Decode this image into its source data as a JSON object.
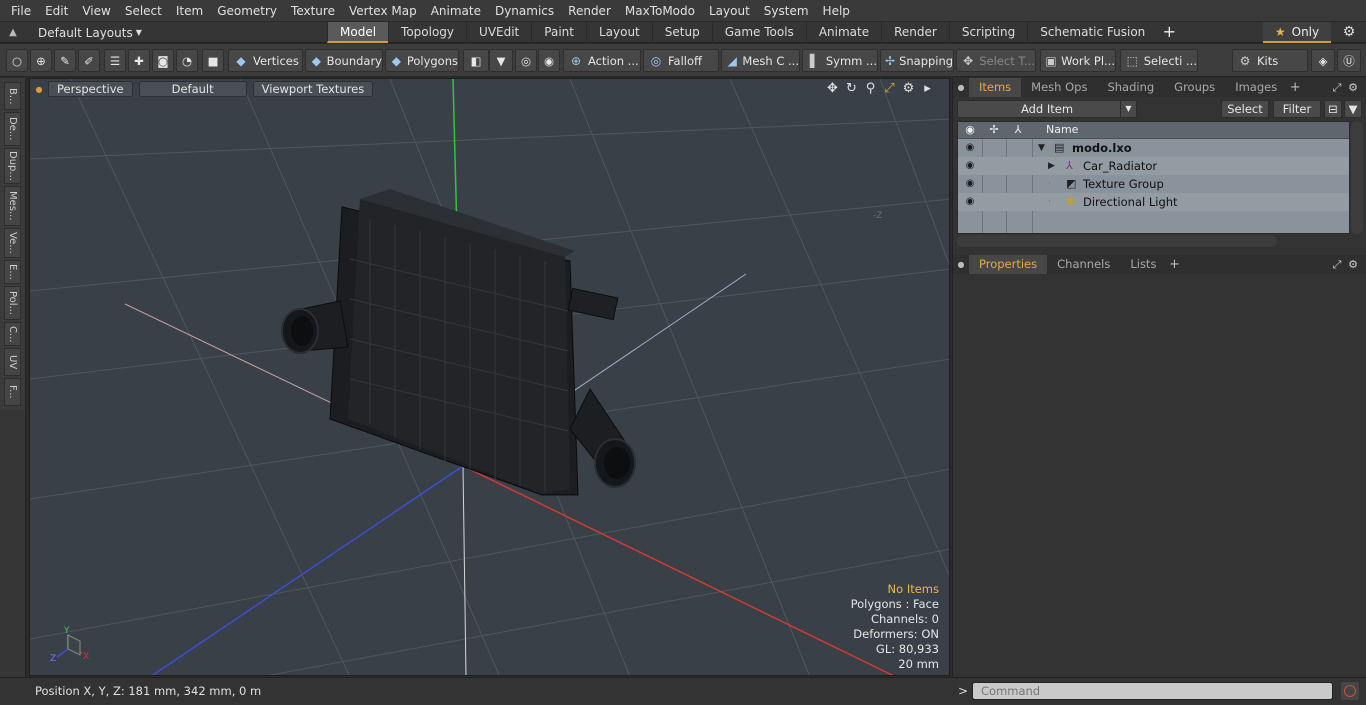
{
  "menu": [
    "File",
    "Edit",
    "View",
    "Select",
    "Item",
    "Geometry",
    "Texture",
    "Vertex Map",
    "Animate",
    "Dynamics",
    "Render",
    "MaxToModo",
    "Layout",
    "System",
    "Help"
  ],
  "layouts": {
    "label": "Default Layouts"
  },
  "tabs": [
    "Model",
    "Topology",
    "UVEdit",
    "Paint",
    "Layout",
    "Setup",
    "Game Tools",
    "Animate",
    "Render",
    "Scripting",
    "Schematic Fusion"
  ],
  "only_label": "Only",
  "toolbar": {
    "vertices": "Vertices",
    "boundary": "Boundary",
    "polygons": "Polygons",
    "action": "Action ...",
    "falloff": "Falloff",
    "mesh": "Mesh C ...",
    "symm": "Symm ...",
    "snapping": "Snapping",
    "select_t": "Select T...",
    "work_pl": "Work Pl...",
    "selecti": "Selecti ...",
    "kits": "Kits"
  },
  "left_tabs": [
    "B...",
    "De...",
    "Dup...",
    "Mes...",
    "Ve...",
    "E...",
    "Pol...",
    "C...",
    "UV",
    "F..."
  ],
  "viewport": {
    "perspective": "Perspective",
    "default": "Default",
    "textures": "Viewport Textures",
    "neg_z": "-Z",
    "axis_x": "X",
    "axis_y": "Y",
    "axis_z": "Z"
  },
  "stats": {
    "no_items": "No Items",
    "polygons": "Polygons : Face",
    "channels": "Channels: 0",
    "deformers": "Deformers: ON",
    "gl": "GL: 80,933",
    "scale": "20 mm"
  },
  "status": {
    "position": "Position X, Y, Z:   181 mm, 342 mm, 0 m"
  },
  "items_panel": {
    "tabs": [
      "Items",
      "Mesh Ops",
      "Shading",
      "Groups",
      "Images"
    ],
    "add_item": "Add Item",
    "select": "Select",
    "filter": "Filter",
    "name_header": "Name",
    "rows": [
      {
        "name": "modo.lxo"
      },
      {
        "name": "Car_Radiator"
      },
      {
        "name": "Texture Group"
      },
      {
        "name": "Directional Light"
      }
    ]
  },
  "properties_panel": {
    "tabs": [
      "Properties",
      "Channels",
      "Lists"
    ]
  },
  "command": {
    "placeholder": "Command"
  },
  "colors": {
    "accent": "#d89a3a",
    "viewport_bg": "#3a4047",
    "item_list_bg": "#8a929b"
  }
}
